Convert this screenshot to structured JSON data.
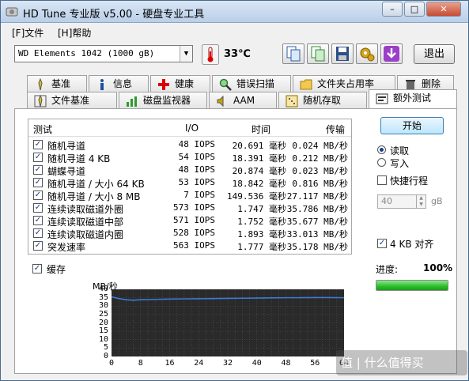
{
  "window": {
    "title": "HD Tune 专业版 v5.00 - 硬盘专业工具"
  },
  "menu": {
    "file": "[F]文件",
    "help": "[H]帮助"
  },
  "toolbar": {
    "drive": "WD      Elements 1042    (1000 gB)",
    "temperature": "33℃",
    "exit_label": "退出"
  },
  "tabs_row1": [
    {
      "label": "基准",
      "icon": "benchmark-icon"
    },
    {
      "label": "信息",
      "icon": "info-icon"
    },
    {
      "label": "健康",
      "icon": "health-icon"
    },
    {
      "label": "错误扫描",
      "icon": "error-scan-icon"
    },
    {
      "label": "文件夹占用率",
      "icon": "folder-usage-icon"
    },
    {
      "label": "删除",
      "icon": "erase-icon"
    }
  ],
  "tabs_row2": [
    {
      "label": "文件基准",
      "icon": "file-benchmark-icon"
    },
    {
      "label": "磁盘监视器",
      "icon": "disk-monitor-icon"
    },
    {
      "label": "AAM",
      "icon": "speaker-icon"
    },
    {
      "label": "随机存取",
      "icon": "random-access-icon"
    },
    {
      "label": "额外测试",
      "icon": "extra-tests-icon",
      "active": true
    }
  ],
  "table": {
    "headers": {
      "test": "测试",
      "io": "I/O",
      "time": "时间",
      "transfer": "传输"
    },
    "rows": [
      {
        "name": "随机寻道",
        "iops": "48 IOPS",
        "time": "20.691 毫秒",
        "transfer": "0.024 MB/秒",
        "checked": true
      },
      {
        "name": "随机寻道 4 KB",
        "iops": "54 IOPS",
        "time": "18.391 毫秒",
        "transfer": "0.212 MB/秒",
        "checked": true
      },
      {
        "name": "蝴蝶寻道",
        "iops": "48 IOPS",
        "time": "20.874 毫秒",
        "transfer": "0.023 MB/秒",
        "checked": true
      },
      {
        "name": "随机寻道 / 大小 64 KB",
        "iops": "53 IOPS",
        "time": "18.842 毫秒",
        "transfer": "0.816 MB/秒",
        "checked": true
      },
      {
        "name": "随机寻道 / 大小 8 MB",
        "iops": "7 IOPS",
        "time": "149.536 毫秒",
        "transfer": "27.117 MB/秒",
        "checked": true
      },
      {
        "name": "连续读取磁道外圈",
        "iops": "573 IOPS",
        "time": "1.747 毫秒",
        "transfer": "35.786 MB/秒",
        "checked": true
      },
      {
        "name": "连续读取磁道中部",
        "iops": "571 IOPS",
        "time": "1.752 毫秒",
        "transfer": "35.677 MB/秒",
        "checked": true
      },
      {
        "name": "连续读取磁道内圈",
        "iops": "528 IOPS",
        "time": "1.893 毫秒",
        "transfer": "33.013 MB/秒",
        "checked": true
      },
      {
        "name": "突发速率",
        "iops": "563 IOPS",
        "time": "1.777 毫秒",
        "transfer": "35.178 MB/秒",
        "checked": true
      }
    ]
  },
  "cache": {
    "label": "缓存",
    "checked": true
  },
  "controls": {
    "start_label": "开始",
    "read_label": "读取",
    "write_label": "写入",
    "mode": "read",
    "quick_stroke_label": "快捷行程",
    "quick_stroke_value": "40",
    "quick_stroke_unit": "gB",
    "align_label": "4 KB 对齐",
    "align_checked": true,
    "progress_label": "进度:",
    "progress_text": "100%",
    "progress": 1.0
  },
  "chart_data": {
    "type": "line",
    "ylabel": "MB/秒",
    "ylim": [
      0,
      40
    ],
    "yticks": [
      0,
      5,
      10,
      15,
      20,
      25,
      30,
      35,
      40
    ],
    "xticks": [
      0,
      8,
      16,
      24,
      32,
      40,
      48,
      56,
      64
    ],
    "xlim": [
      0,
      64
    ],
    "series": [
      {
        "color": "#3a7bd5",
        "x": [
          0,
          2,
          4,
          6,
          8,
          12,
          16,
          20,
          24,
          28,
          32,
          36,
          40,
          44,
          48,
          52,
          56,
          60,
          64
        ],
        "values": [
          35.5,
          34.5,
          33.8,
          33.5,
          33.8,
          34.0,
          34.2,
          34.3,
          34.4,
          34.5,
          34.6,
          34.7,
          34.8,
          34.9,
          35.0,
          35.0,
          35.1,
          35.1,
          35.0
        ]
      }
    ],
    "grid": true,
    "background": "#2a2a2a"
  },
  "watermark": "值 | 什么值得买"
}
